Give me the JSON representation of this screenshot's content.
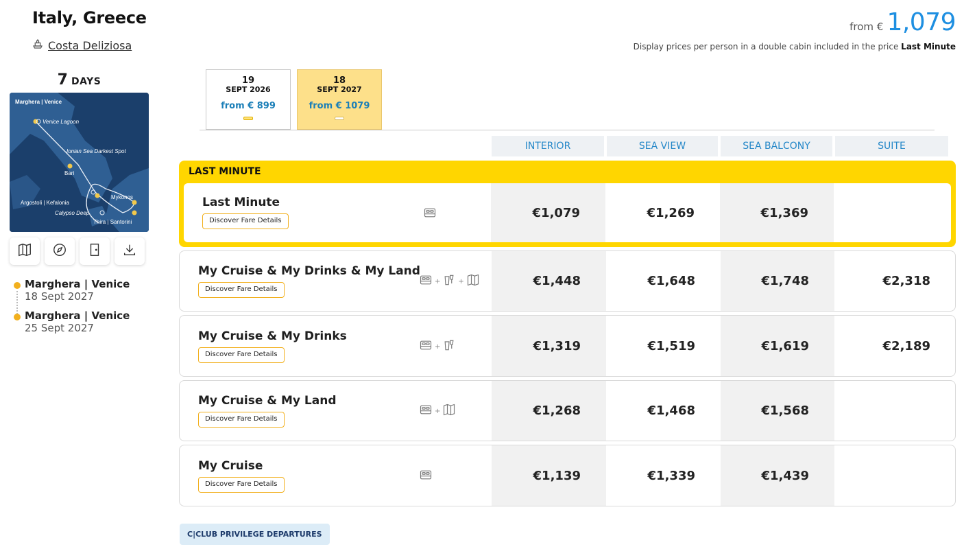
{
  "header": {
    "title": "Italy, Greece",
    "ship_name": "Costa Deliziosa",
    "ship_icon": "ship-icon"
  },
  "duration": {
    "number": "7",
    "label": "DAYS"
  },
  "map": {
    "labels": [
      "Marghera | Venice",
      "Venice Lagoon",
      "Ionian Sea Darkest Spot",
      "Bari",
      "Argostoli | Kefalonia",
      "Mykonos",
      "Calypso Deep",
      "Thira | Santorini"
    ]
  },
  "map_tools": [
    {
      "icon": "map-icon"
    },
    {
      "icon": "compass-icon"
    },
    {
      "icon": "door-icon"
    },
    {
      "icon": "download-icon"
    }
  ],
  "itinerary": [
    {
      "port": "Marghera | Venice",
      "date": "18 Sept 2027"
    },
    {
      "port": "Marghera | Venice",
      "date": "25 Sept 2027"
    }
  ],
  "price_summary": {
    "from_label": "from €",
    "amount": "1,079",
    "note_text": "Display prices per person in a double cabin included in the price",
    "note_bold": "Last Minute"
  },
  "date_tabs": [
    {
      "day": "19",
      "month": "SEPT 2026",
      "from": "from € 899",
      "active": false
    },
    {
      "day": "18",
      "month": "SEPT 2027",
      "from": "from € 1079",
      "active": true
    }
  ],
  "cabin_columns": [
    "INTERIOR",
    "SEA VIEW",
    "SEA BALCONY",
    "SUITE"
  ],
  "last_minute_label": "LAST MINUTE",
  "fares": [
    {
      "name": "Last Minute",
      "details_label": "Discover Fare Details",
      "icons": [
        "bed-icon"
      ],
      "prices": [
        "€1,079",
        "€1,269",
        "€1,369",
        ""
      ]
    },
    {
      "name": "My Cruise & My Drinks & My Land",
      "details_label": "Discover Fare Details",
      "icons": [
        "bed-icon",
        "drinks-icon",
        "excursion-map-icon"
      ],
      "prices": [
        "€1,448",
        "€1,648",
        "€1,748",
        "€2,318"
      ]
    },
    {
      "name": "My Cruise & My Drinks",
      "details_label": "Discover Fare Details",
      "icons": [
        "bed-icon",
        "drinks-icon"
      ],
      "prices": [
        "€1,319",
        "€1,519",
        "€1,619",
        "€2,189"
      ]
    },
    {
      "name": "My Cruise & My Land",
      "details_label": "Discover Fare Details",
      "icons": [
        "bed-icon",
        "excursion-map-icon"
      ],
      "prices": [
        "€1,268",
        "€1,468",
        "€1,568",
        ""
      ]
    },
    {
      "name": "My Cruise",
      "details_label": "Discover Fare Details",
      "icons": [
        "bed-icon"
      ],
      "prices": [
        "€1,139",
        "€1,339",
        "€1,439",
        ""
      ]
    }
  ],
  "club_badge": "C|CLUB PRIVILEGE DEPARTURES",
  "colors": {
    "accent_yellow": "#ffd600",
    "price_blue": "#1e8fe1",
    "header_blue": "#2487c8",
    "dot_orange": "#f2b01e",
    "map_sea": "#1b3f6b"
  }
}
